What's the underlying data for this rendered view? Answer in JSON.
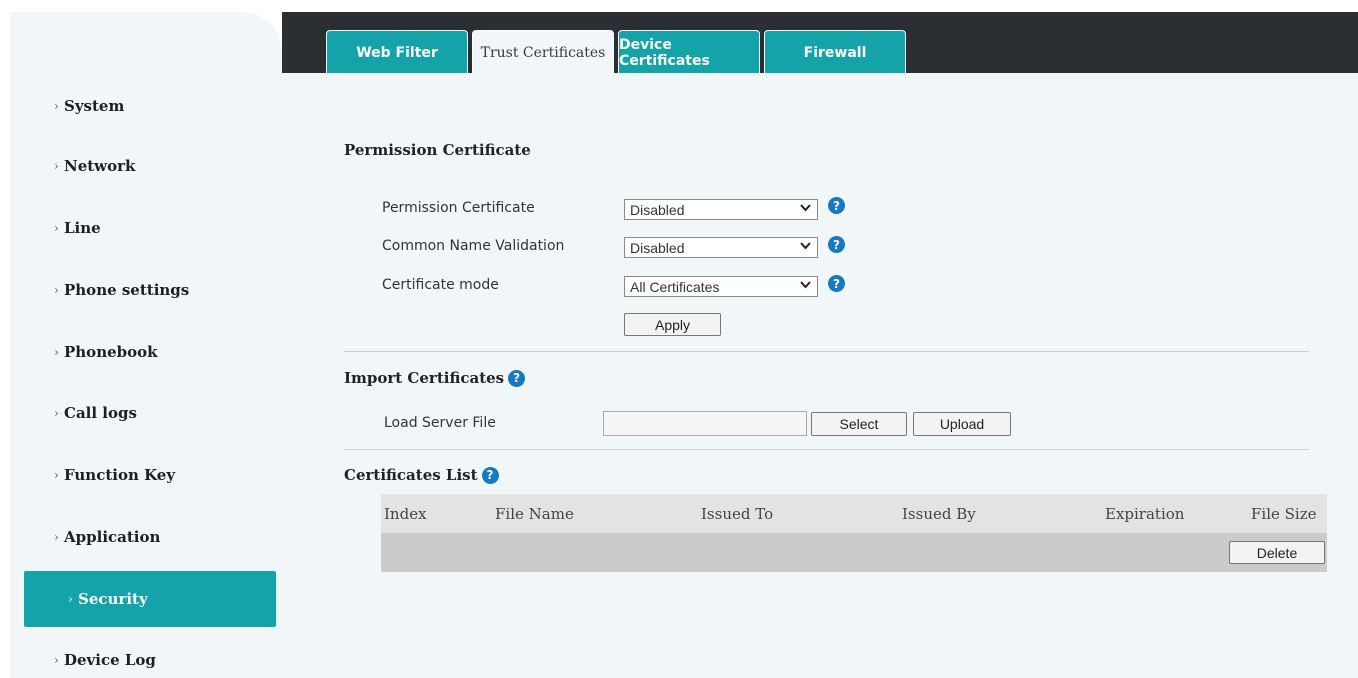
{
  "tabs": [
    "Web Filter",
    "Trust Certificates",
    "Device Certificates",
    "Firewall"
  ],
  "sidebar": {
    "items": [
      {
        "label": "System"
      },
      {
        "label": "Network"
      },
      {
        "label": "Line"
      },
      {
        "label": "Phone settings"
      },
      {
        "label": "Phonebook"
      },
      {
        "label": "Call logs"
      },
      {
        "label": "Function Key"
      },
      {
        "label": "Application"
      },
      {
        "label": "Security"
      },
      {
        "label": "Device Log"
      }
    ],
    "chevron": "›"
  },
  "permission": {
    "title": "Permission Certificate",
    "fields": [
      {
        "label": "Permission Certificate",
        "value": "Disabled"
      },
      {
        "label": "Common Name Validation",
        "value": "Disabled"
      },
      {
        "label": "Certificate mode",
        "value": "All Certificates"
      }
    ],
    "apply": "Apply"
  },
  "import": {
    "title": "Import Certificates",
    "label": "Load Server File",
    "select": "Select",
    "upload": "Upload"
  },
  "list": {
    "title": "Certificates List",
    "headers": [
      "Index",
      "File Name",
      "Issued To",
      "Issued By",
      "Expiration",
      "File Size"
    ],
    "delete": "Delete"
  },
  "icons": {
    "help": "?",
    "dropdown": "⌄"
  },
  "colors": {
    "accent": "#13a3a9",
    "topbar": "#2b2f33",
    "panel": "#f1f7f9",
    "help": "#1679c7"
  }
}
